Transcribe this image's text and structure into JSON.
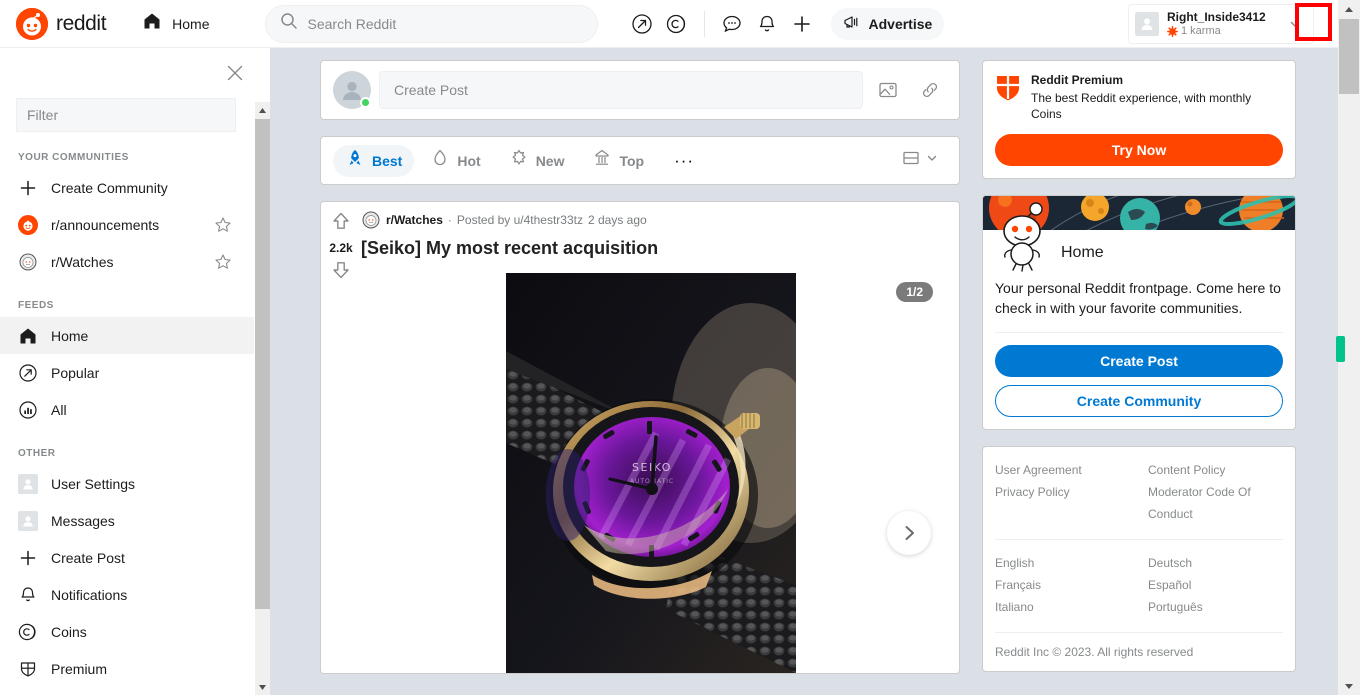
{
  "topnav": {
    "brand": "reddit",
    "home_label": "Home",
    "search_placeholder": "Search Reddit",
    "search_value": "",
    "advertise_label": "Advertise",
    "icons": [
      "popular-icon",
      "coins-icon",
      "chat-icon",
      "notifications-icon",
      "create-icon"
    ],
    "user": {
      "name": "Right_Inside3412",
      "karma": "1 karma"
    }
  },
  "sidebar": {
    "filter_placeholder": "Filter",
    "filter_value": "",
    "sections": [
      {
        "heading": "YOUR COMMUNITIES",
        "items": [
          {
            "label": "Create Community",
            "icon": "plus-icon",
            "star": false
          },
          {
            "label": "r/announcements",
            "icon": "reddit-avatar-icon",
            "star": true
          },
          {
            "label": "r/Watches",
            "icon": "watches-avatar-icon",
            "star": true
          }
        ]
      },
      {
        "heading": "FEEDS",
        "items": [
          {
            "label": "Home",
            "icon": "home-icon",
            "active": true
          },
          {
            "label": "Popular",
            "icon": "popular-icon"
          },
          {
            "label": "All",
            "icon": "all-icon"
          }
        ]
      },
      {
        "heading": "OTHER",
        "items": [
          {
            "label": "User Settings",
            "icon": "user-settings-icon"
          },
          {
            "label": "Messages",
            "icon": "messages-icon"
          },
          {
            "label": "Create Post",
            "icon": "plus-icon"
          },
          {
            "label": "Notifications",
            "icon": "bell-icon"
          },
          {
            "label": "Coins",
            "icon": "coins-icon"
          },
          {
            "label": "Premium",
            "icon": "premium-shield-icon"
          }
        ]
      }
    ]
  },
  "main": {
    "create_post": {
      "placeholder": "Create Post",
      "value": "",
      "image_button": "image-icon",
      "link_button": "link-icon"
    },
    "sort": {
      "tabs": [
        {
          "label": "Best",
          "icon": "rocket-icon",
          "active": true
        },
        {
          "label": "Hot",
          "icon": "flame-icon",
          "active": false
        },
        {
          "label": "New",
          "icon": "sparkle-icon",
          "active": false
        },
        {
          "label": "Top",
          "icon": "chart-icon",
          "active": false
        }
      ],
      "more": "···",
      "layout": "card-layout-icon"
    },
    "post": {
      "votes": "2.2k",
      "subreddit": "r/Watches",
      "separator": "·",
      "posted_by": "Posted by u/4thestr33tz",
      "age": "2 days ago",
      "title": "[Seiko] My most recent acquisition",
      "image_counter": "1/2",
      "next_button": "chevron-right-icon"
    }
  },
  "rail": {
    "premium": {
      "title": "Reddit Premium",
      "subtitle": "The best Reddit experience, with monthly Coins",
      "cta": "Try Now"
    },
    "home": {
      "title": "Home",
      "description": "Your personal Reddit frontpage. Come here to check in with your favorite communities.",
      "create_post": "Create Post",
      "create_community": "Create Community"
    },
    "footer": {
      "links": [
        "User Agreement",
        "Content Policy",
        "Privacy Policy",
        "Moderator Code Of Conduct"
      ],
      "languages": [
        "English",
        "Deutsch",
        "Français",
        "Español",
        "Italiano",
        "Português"
      ],
      "copyright": "Reddit Inc © 2023. All rights reserved"
    }
  },
  "colors": {
    "brand_orange": "#ff4500",
    "link_blue": "#0079d3",
    "page_bg": "#dae0e6",
    "highlight_red": "#ff0000",
    "online_green": "#46d160"
  }
}
